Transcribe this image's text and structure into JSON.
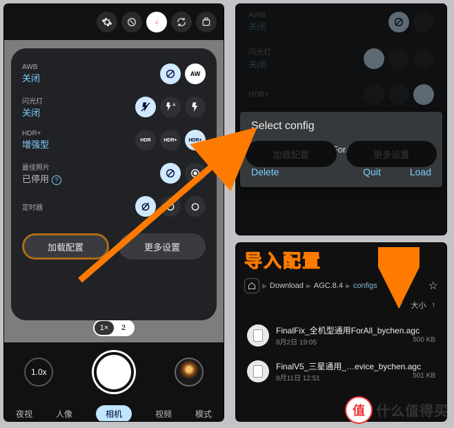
{
  "left": {
    "settings": {
      "awb": {
        "label": "AWB",
        "value": "关闭"
      },
      "flash": {
        "label": "闪光灯",
        "value": "关闭"
      },
      "hdr": {
        "label": "HDR+",
        "value": "增强型"
      },
      "best": {
        "label": "最佳照片",
        "value": "已停用"
      },
      "timer": {
        "label": "定时器",
        "value": ""
      }
    },
    "icons": {
      "awb_off": "AWB-off",
      "awb_on": "AW",
      "flash_off": "flash-off",
      "flash_auto": "flash-auto",
      "flash_on": "flash-on",
      "hdr_off": "HDR",
      "hdr_on": "HDR+",
      "hdr_enh": "HDR+",
      "best_off": "best-off",
      "best_on": "best-on",
      "timer_off": "timer-off",
      "timer_3": "3",
      "timer_10": "10"
    },
    "buttons": {
      "load_cfg": "加载配置",
      "more": "更多设置"
    },
    "zoom_pill": {
      "a": "1×",
      "b": "2"
    },
    "zoom_ind": "1.0x",
    "modes": {
      "m1": "夜视",
      "m2": "人像",
      "m3": "相机",
      "m4": "视频",
      "m5": "模式"
    }
  },
  "rtop": {
    "awb": {
      "label": "AWB",
      "value": "关闭"
    },
    "flash": {
      "label": "闪光灯",
      "value": "关闭"
    },
    "hdr": {
      "label": "HDR+",
      "value": ""
    },
    "dialog": {
      "title": "Select config",
      "filename": "FinalFix_全机型通用ForAll_by…",
      "delete": "Delete",
      "quit": "Quit",
      "load": "Load"
    },
    "buttons": {
      "load_cfg": "加载配置",
      "more": "更多设置"
    }
  },
  "rbot": {
    "import_label": "导入配置",
    "breadcrumb": {
      "b1": "Download",
      "b2": "AGC.8.4",
      "b3": "configs"
    },
    "sort": {
      "label": "大小"
    },
    "files": [
      {
        "name": "FinalFix_全机型通用ForAll_bychen.agc",
        "date": "8月2日 19:05",
        "size": "500 KB"
      },
      {
        "name": "FinalV5_三星通用_…evice_bychen.agc",
        "date": "8月11日 12:51",
        "size": "501 KB"
      }
    ]
  },
  "watermark": {
    "circle": "值",
    "text": "什么值得买"
  }
}
